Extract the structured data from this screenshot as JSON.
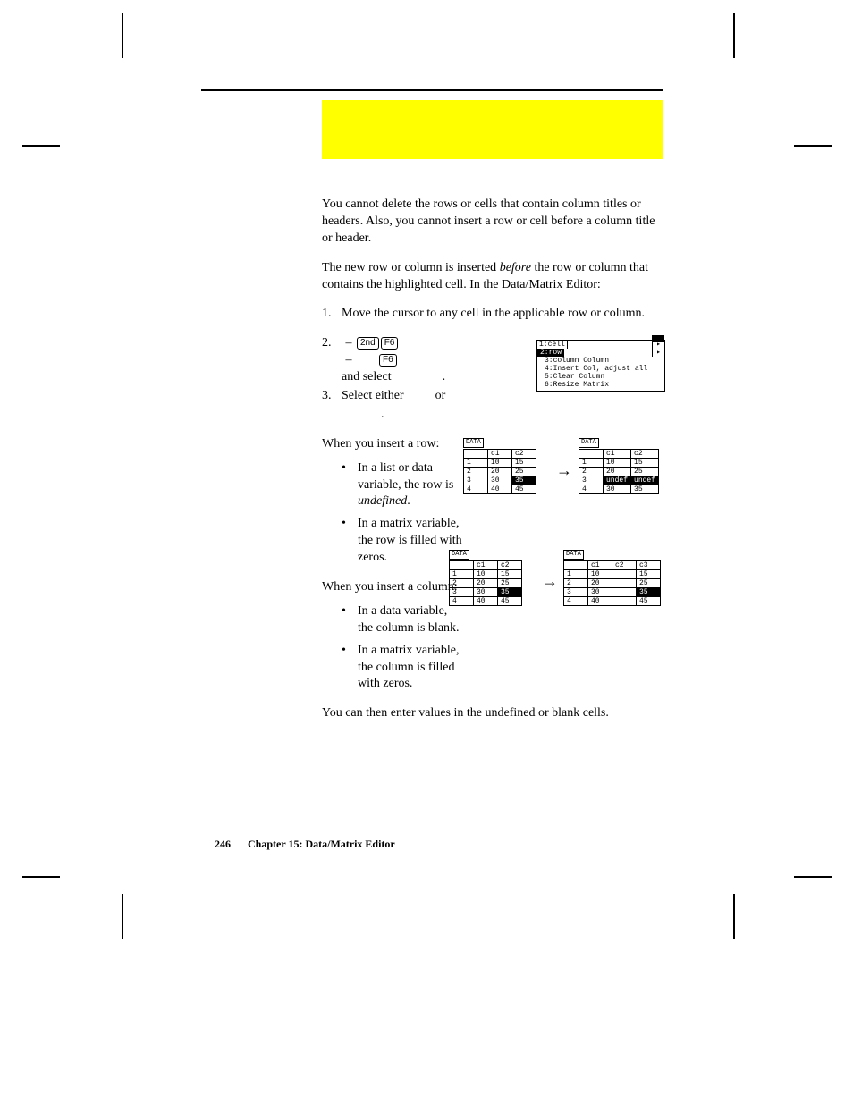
{
  "intro_note": "You cannot delete the rows or cells that contain column titles or headers. Also, you cannot insert a row or cell before a column title or header.",
  "insert_intro_a": "The new row or column is inserted ",
  "insert_intro_em": "before",
  "insert_intro_b": " the row or column that contains the highlighted cell. In the Data/Matrix Editor:",
  "step1": {
    "num": "1.",
    "text": "Move the cursor to any cell in the applicable row or column."
  },
  "step2": {
    "num": "2.",
    "key1": "2nd",
    "key2": "F6",
    "key3": "F6",
    "tail": "and select",
    "period": "."
  },
  "step3": {
    "num": "3.",
    "lead": "Select either",
    "mid": "or",
    "end": "."
  },
  "row_heading": "When you insert a row:",
  "row_b1_a": "In a list or data variable, the row is ",
  "row_b1_em": "undefined",
  "row_b1_b": ".",
  "row_b2": "In a matrix variable, the row is filled with zeros.",
  "col_heading": "When you insert a column:",
  "col_b1": "In a data variable, the column is blank.",
  "col_b2": "In a matrix variable, the column is filled with zeros.",
  "closing": "You can then enter values in the undefined or blank cells.",
  "footer": {
    "page": "246",
    "chapter": "Chapter 15: Data/Matrix Editor"
  },
  "calc_menu": {
    "tab1": "1:cell",
    "tab2_inv": "2:row",
    "l1": "3:column Column",
    "l2": "4:Insert Col, adjust all",
    "l3": "5:Clear Column",
    "l4": "6:Resize Matrix"
  },
  "shots": {
    "label": "DATA",
    "r1a": {
      "hdr": [
        "",
        "c1",
        "c2"
      ],
      "rows": [
        [
          "1",
          "10",
          "15"
        ],
        [
          "2",
          "20",
          "25"
        ],
        [
          "3",
          "30",
          "35"
        ],
        [
          "4",
          "40",
          "45"
        ]
      ],
      "sel": [
        2,
        2
      ]
    },
    "r1b": {
      "hdr": [
        "",
        "c1",
        "c2"
      ],
      "rows": [
        [
          "1",
          "10",
          "15"
        ],
        [
          "2",
          "20",
          "25"
        ],
        [
          "3",
          "undef",
          "undef"
        ],
        [
          "4",
          "30",
          "35"
        ]
      ],
      "sel_row": 2
    },
    "r2a": {
      "hdr": [
        "",
        "c1",
        "c2"
      ],
      "rows": [
        [
          "1",
          "10",
          "15"
        ],
        [
          "2",
          "20",
          "25"
        ],
        [
          "3",
          "30",
          "35"
        ],
        [
          "4",
          "40",
          "45"
        ]
      ],
      "sel": [
        2,
        2
      ]
    },
    "r2b": {
      "hdr": [
        "",
        "c1",
        "c2",
        "c3"
      ],
      "rows": [
        [
          "1",
          "10",
          "",
          "15"
        ],
        [
          "2",
          "20",
          "",
          "25"
        ],
        [
          "3",
          "30",
          "",
          "35"
        ],
        [
          "4",
          "40",
          "",
          "45"
        ]
      ],
      "sel": [
        2,
        3
      ]
    }
  }
}
